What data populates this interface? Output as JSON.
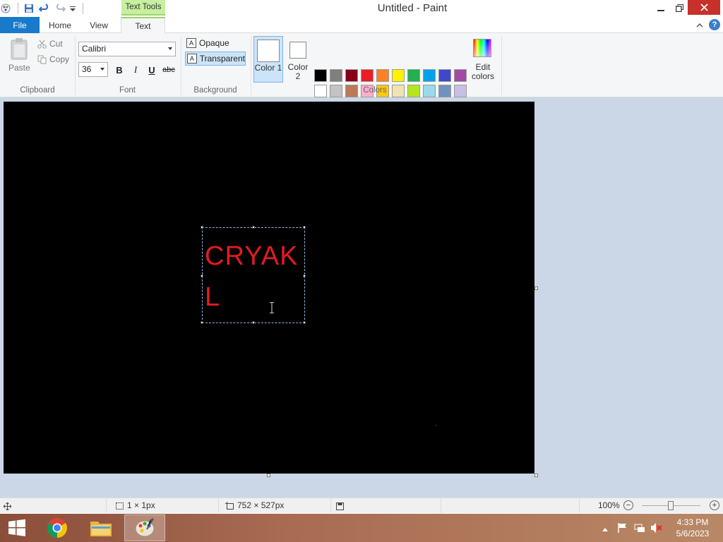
{
  "window": {
    "title": "Untitled - Paint",
    "context_tab": "Text Tools"
  },
  "tabs": {
    "file": "File",
    "home": "Home",
    "view": "View",
    "text": "Text"
  },
  "clipboard": {
    "group_label": "Clipboard",
    "paste": "Paste",
    "cut": "Cut",
    "copy": "Copy"
  },
  "font": {
    "group_label": "Font",
    "family": "Calibri",
    "size": "36",
    "bold": "B",
    "italic": "I",
    "underline": "U",
    "strikethrough": "abc"
  },
  "background": {
    "group_label": "Background",
    "opaque": "Opaque",
    "transparent": "Transparent",
    "selected": "transparent"
  },
  "colors": {
    "group_label": "Colors",
    "color1_label": "Color 1",
    "color2_label": "Color 2",
    "edit_colors": "Edit colors",
    "color1_value": "#ffffff",
    "color2_value": "#ffffff",
    "palette_row1": [
      "#000000",
      "#7f7f7f",
      "#880015",
      "#ed1c24",
      "#ff7f27",
      "#fff200",
      "#22b14c",
      "#00a2e8",
      "#3f48cc",
      "#a349a4"
    ],
    "palette_row2": [
      "#ffffff",
      "#c3c3c3",
      "#b97a57",
      "#ffaec9",
      "#ffc90e",
      "#efe4b0",
      "#b5e61d",
      "#99d9ea",
      "#7092be",
      "#c8bfe7"
    ]
  },
  "canvas": {
    "background": "#000000",
    "text_line1": "CRYAK",
    "text_line2": "L",
    "text_color": "#e21b23"
  },
  "status": {
    "selection_size": "1 × 1px",
    "image_size": "752 × 527px",
    "zoom": "100%"
  },
  "taskbar": {
    "time": "4:33 PM",
    "date": "5/6/2023"
  }
}
